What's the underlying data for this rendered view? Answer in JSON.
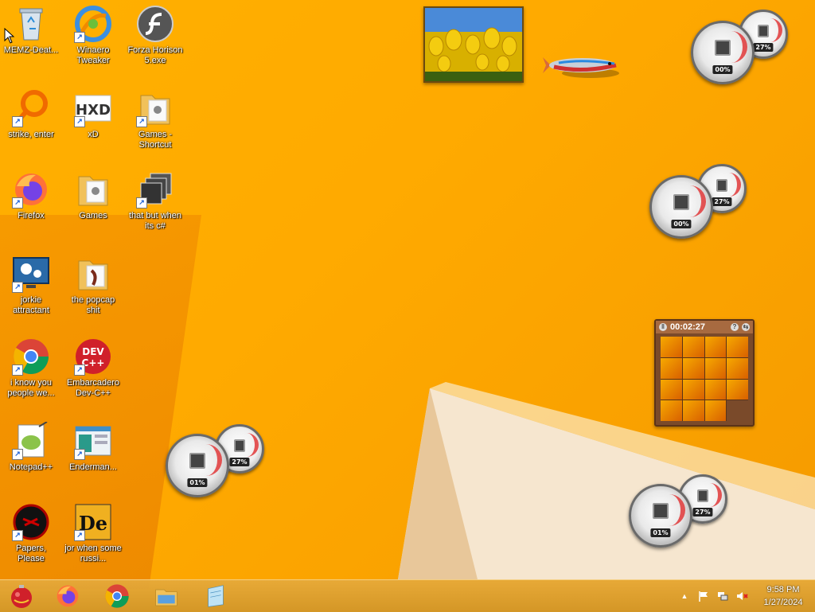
{
  "desktop_icons": [
    {
      "label": "MEMZ-Deat..."
    },
    {
      "label": "Winaero Tweaker"
    },
    {
      "label": "Forza Horison 5.exe"
    },
    {
      "label": "strike, enter"
    },
    {
      "label": "xD"
    },
    {
      "label": "Games - Shortcut"
    },
    {
      "label": "Firefox"
    },
    {
      "label": "Games"
    },
    {
      "label": "that but when its c#"
    },
    {
      "label": "jorkie attractant"
    },
    {
      "label": "the popcap shit"
    },
    {
      "label": "i know you people we..."
    },
    {
      "label": "Embarcadero Dev-C++"
    },
    {
      "label": "Notepad++"
    },
    {
      "label": "Enderman..."
    },
    {
      "label": "Papers, Please"
    },
    {
      "label": "jor when some russi..."
    }
  ],
  "icon_glyphs": {
    "hxd_text": "HXD",
    "dev_text": "DEV C++",
    "de_text": "De"
  },
  "gadgets": {
    "meters": [
      {
        "cpu": "00%",
        "mem": "27%"
      },
      {
        "cpu": "00%",
        "mem": "27%"
      },
      {
        "cpu": "01%",
        "mem": "27%"
      },
      {
        "cpu": "01%",
        "mem": "27%"
      }
    ],
    "puzzle": {
      "timer": "00:02:27",
      "help": "?",
      "toggle": "⇆"
    }
  },
  "tray": {
    "time": "9:58 PM",
    "date": "1/27/2024",
    "chevron": "▲"
  },
  "colors": {
    "wallpaper": "#ffaa00",
    "taskbar": "#d9962a"
  }
}
